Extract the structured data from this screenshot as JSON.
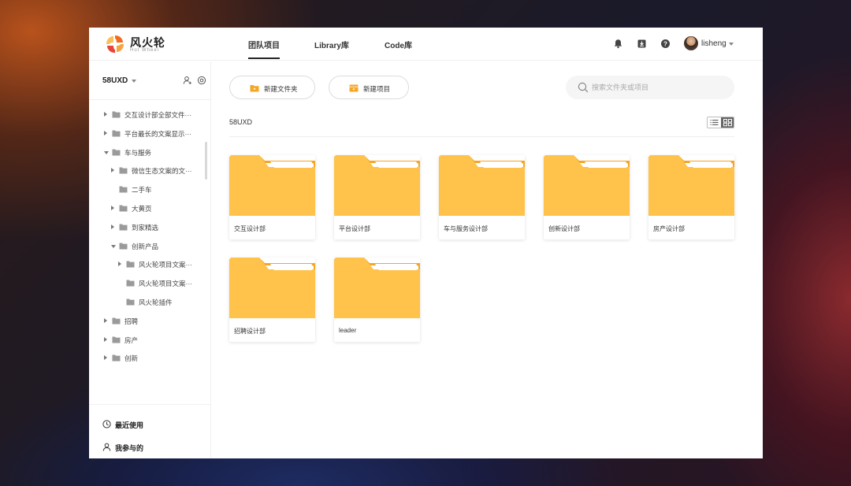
{
  "app": {
    "brand_name": "风火轮",
    "brand_sub": "Hot Wheel",
    "accent": "#ffc24b",
    "accent_dark": "#f5a623"
  },
  "header": {
    "tabs": [
      {
        "label": "团队项目",
        "active": true
      },
      {
        "label": "Library库",
        "active": false
      },
      {
        "label": "Code库",
        "active": false
      }
    ],
    "icons": [
      "bell-icon",
      "download-icon",
      "help-icon"
    ],
    "username": "lisheng"
  },
  "sidebar": {
    "team": "58UXD",
    "tree": [
      {
        "label": "交互设计部全部文件···",
        "depth": 0,
        "arrow": "right"
      },
      {
        "label": "平台最长的文案显示···",
        "depth": 0,
        "arrow": "right"
      },
      {
        "label": "车与服务",
        "depth": 0,
        "arrow": "down"
      },
      {
        "label": "微信生态文案的文···",
        "depth": 1,
        "arrow": "right"
      },
      {
        "label": "二手车",
        "depth": 1,
        "arrow": "none"
      },
      {
        "label": "大黄页",
        "depth": 1,
        "arrow": "right"
      },
      {
        "label": "到家精选",
        "depth": 1,
        "arrow": "right"
      },
      {
        "label": "创新产品",
        "depth": 1,
        "arrow": "down"
      },
      {
        "label": "风火轮项目文案···",
        "depth": 2,
        "arrow": "right"
      },
      {
        "label": "风火轮项目文案···",
        "depth": 2,
        "arrow": "none"
      },
      {
        "label": "风火轮插件",
        "depth": 2,
        "arrow": "none"
      },
      {
        "label": "招聘",
        "depth": 0,
        "arrow": "right"
      },
      {
        "label": "房产",
        "depth": 0,
        "arrow": "right"
      },
      {
        "label": "创新",
        "depth": 0,
        "arrow": "right"
      }
    ],
    "recent_label": "最近使用",
    "participated_label": "我参与的"
  },
  "toolbar": {
    "new_folder_label": "新建文件夹",
    "new_project_label": "新建项目",
    "search_placeholder": "搜索文件夹或项目"
  },
  "main": {
    "breadcrumb": "58UXD",
    "view_mode": "grid",
    "folders": [
      "交互设计部",
      "平台设计部",
      "车与服务设计部",
      "创新设计部",
      "房产设计部",
      "招聘设计部",
      "leader"
    ]
  }
}
